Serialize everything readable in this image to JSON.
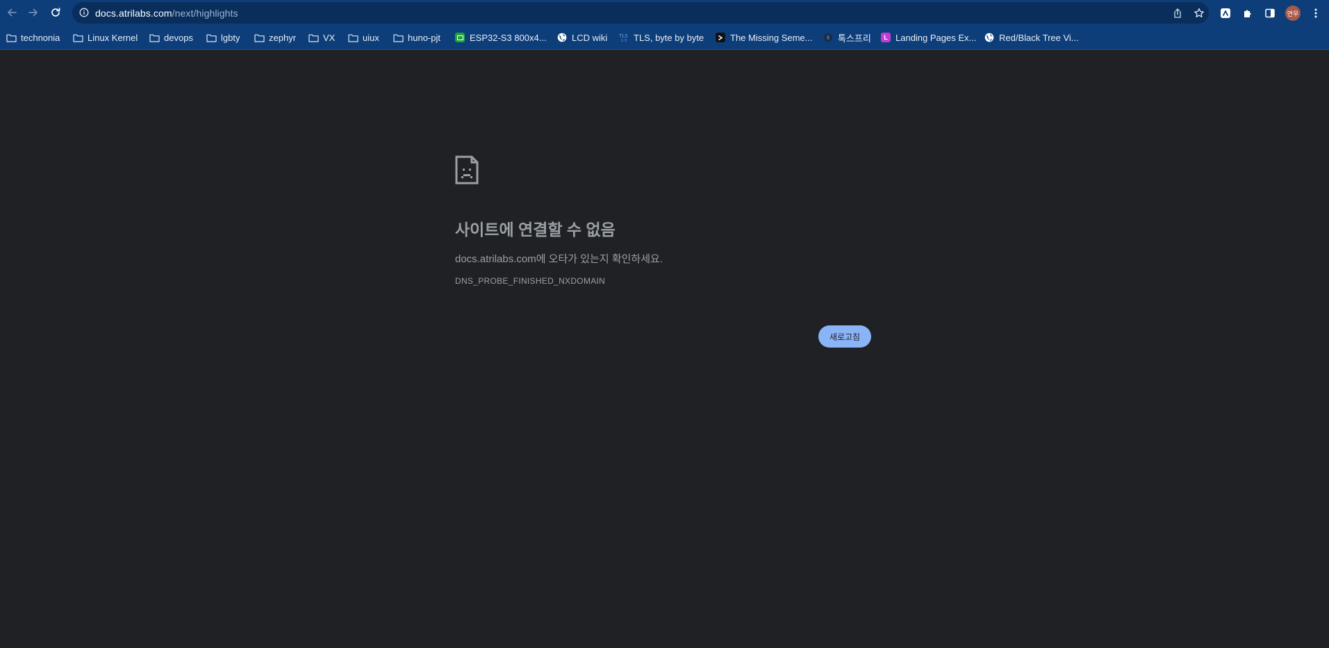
{
  "browser": {
    "url_host": "docs.atrilabs.com",
    "url_path": "/next/highlights",
    "profile_initials": "연우"
  },
  "bookmarks": [
    {
      "label": "technonia",
      "icon": "folder-icon"
    },
    {
      "label": "Linux Kernel",
      "icon": "folder-icon"
    },
    {
      "label": "devops",
      "icon": "folder-icon"
    },
    {
      "label": "lgbty",
      "icon": "folder-icon"
    },
    {
      "label": "zephyr",
      "icon": "folder-icon"
    },
    {
      "label": "VX",
      "icon": "folder-icon"
    },
    {
      "label": "uiux",
      "icon": "folder-icon"
    },
    {
      "label": "huno-pjt",
      "icon": "folder-icon"
    },
    {
      "label": "ESP32-S3 800x4...",
      "icon": "esp-favicon-icon"
    },
    {
      "label": "LCD wiki",
      "icon": "globe-icon"
    },
    {
      "label": "TLS, byte by byte",
      "icon": "tls-favicon-icon"
    },
    {
      "label": "The Missing Seme...",
      "icon": "terminal-favicon-icon"
    },
    {
      "label": "톡스프리",
      "icon": "toksfree-favicon-icon"
    },
    {
      "label": "Landing Pages Ex...",
      "icon": "landing-favicon-icon"
    },
    {
      "label": "Red/Black Tree Vi...",
      "icon": "globe-icon"
    }
  ],
  "error_page": {
    "title": "사이트에 연결할 수 없음",
    "desc_host": "docs.atrilabs.com",
    "desc_rest": "에 오타가 있는지 확인하세요.",
    "error_code": "DNS_PROBE_FINISHED_NXDOMAIN",
    "reload_label": "새로고침"
  },
  "colors": {
    "toolbar_bg": "#0d3e7a",
    "page_bg": "#202124",
    "button_blue": "#8ab4f8",
    "text_grey": "#9aa0a6"
  }
}
